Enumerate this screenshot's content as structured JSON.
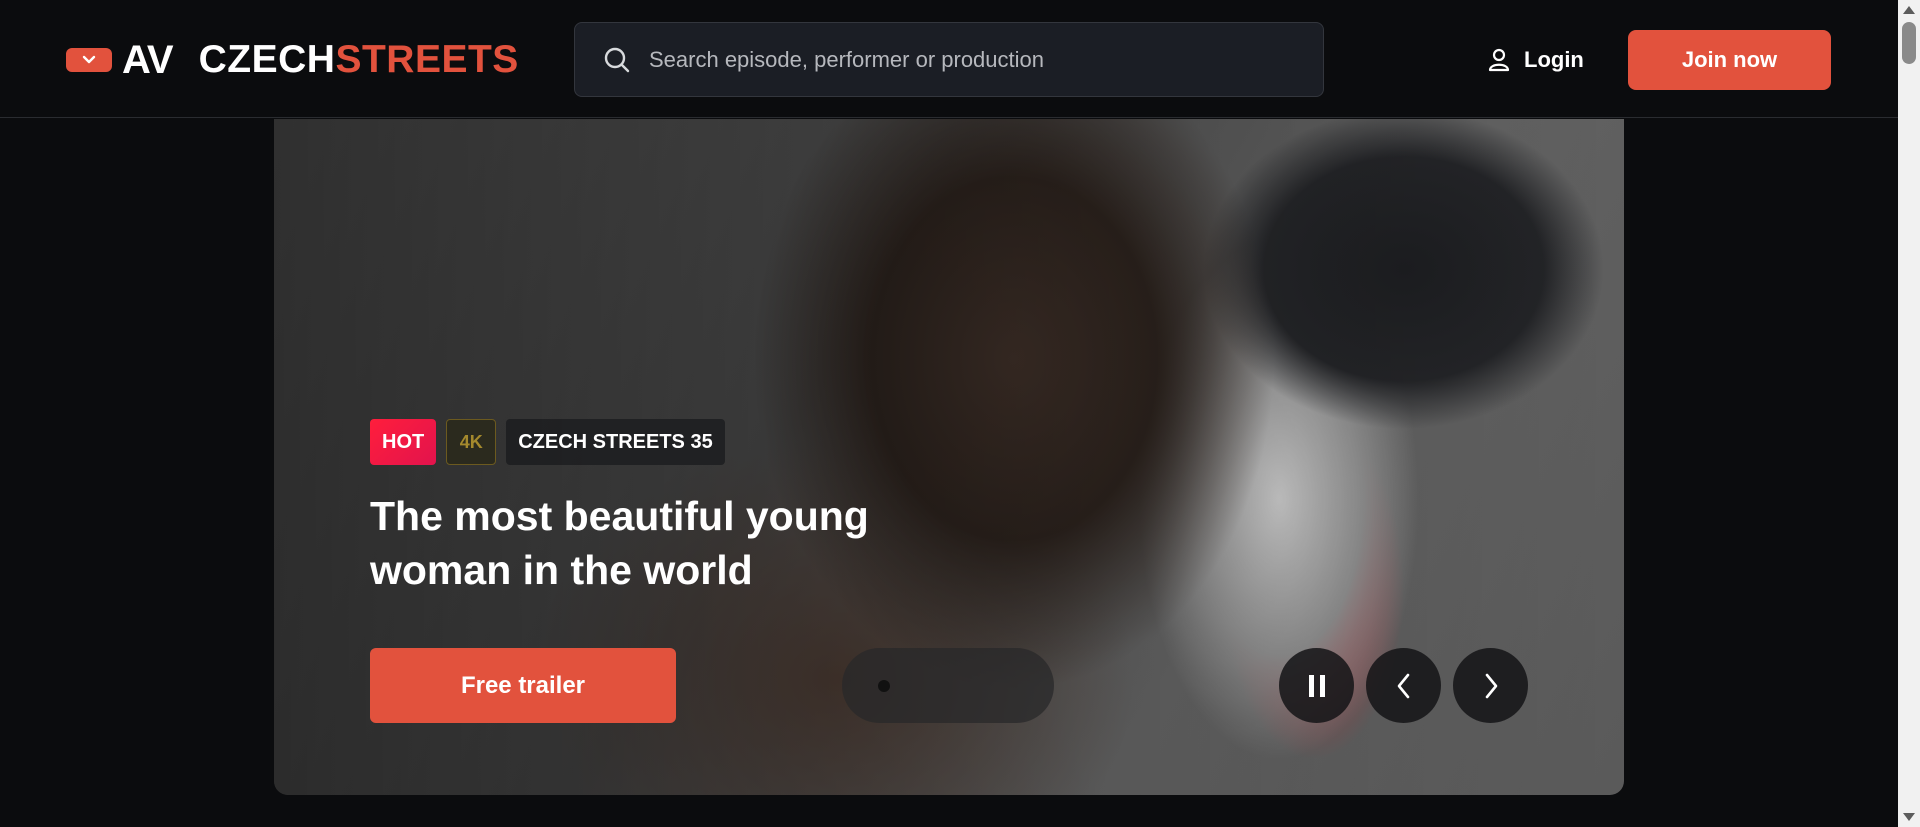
{
  "header": {
    "logo": {
      "badge_icon": "chevron-down-icon",
      "av_text": "AV",
      "brand_part1": "CZECH",
      "brand_part2": "STREETS"
    },
    "search": {
      "placeholder": "Search episode, performer or production",
      "value": "",
      "icon": "search-icon"
    },
    "login": {
      "label": "Login",
      "icon": "user-icon"
    },
    "join_label": "Join now"
  },
  "hero": {
    "badges": {
      "hot": "HOT",
      "quality": "4K",
      "series": "CZECH STREETS 35"
    },
    "title": "The most beautiful young woman in the world",
    "trailer_label": "Free trailer",
    "controls": {
      "pause_icon": "pause-icon",
      "prev_icon": "chevron-left-icon",
      "next_icon": "chevron-right-icon"
    }
  },
  "colors": {
    "accent": "#e2523d",
    "background": "#0b0c0e",
    "search_bg": "#1b1e25",
    "hot": "#ff1e3c"
  }
}
